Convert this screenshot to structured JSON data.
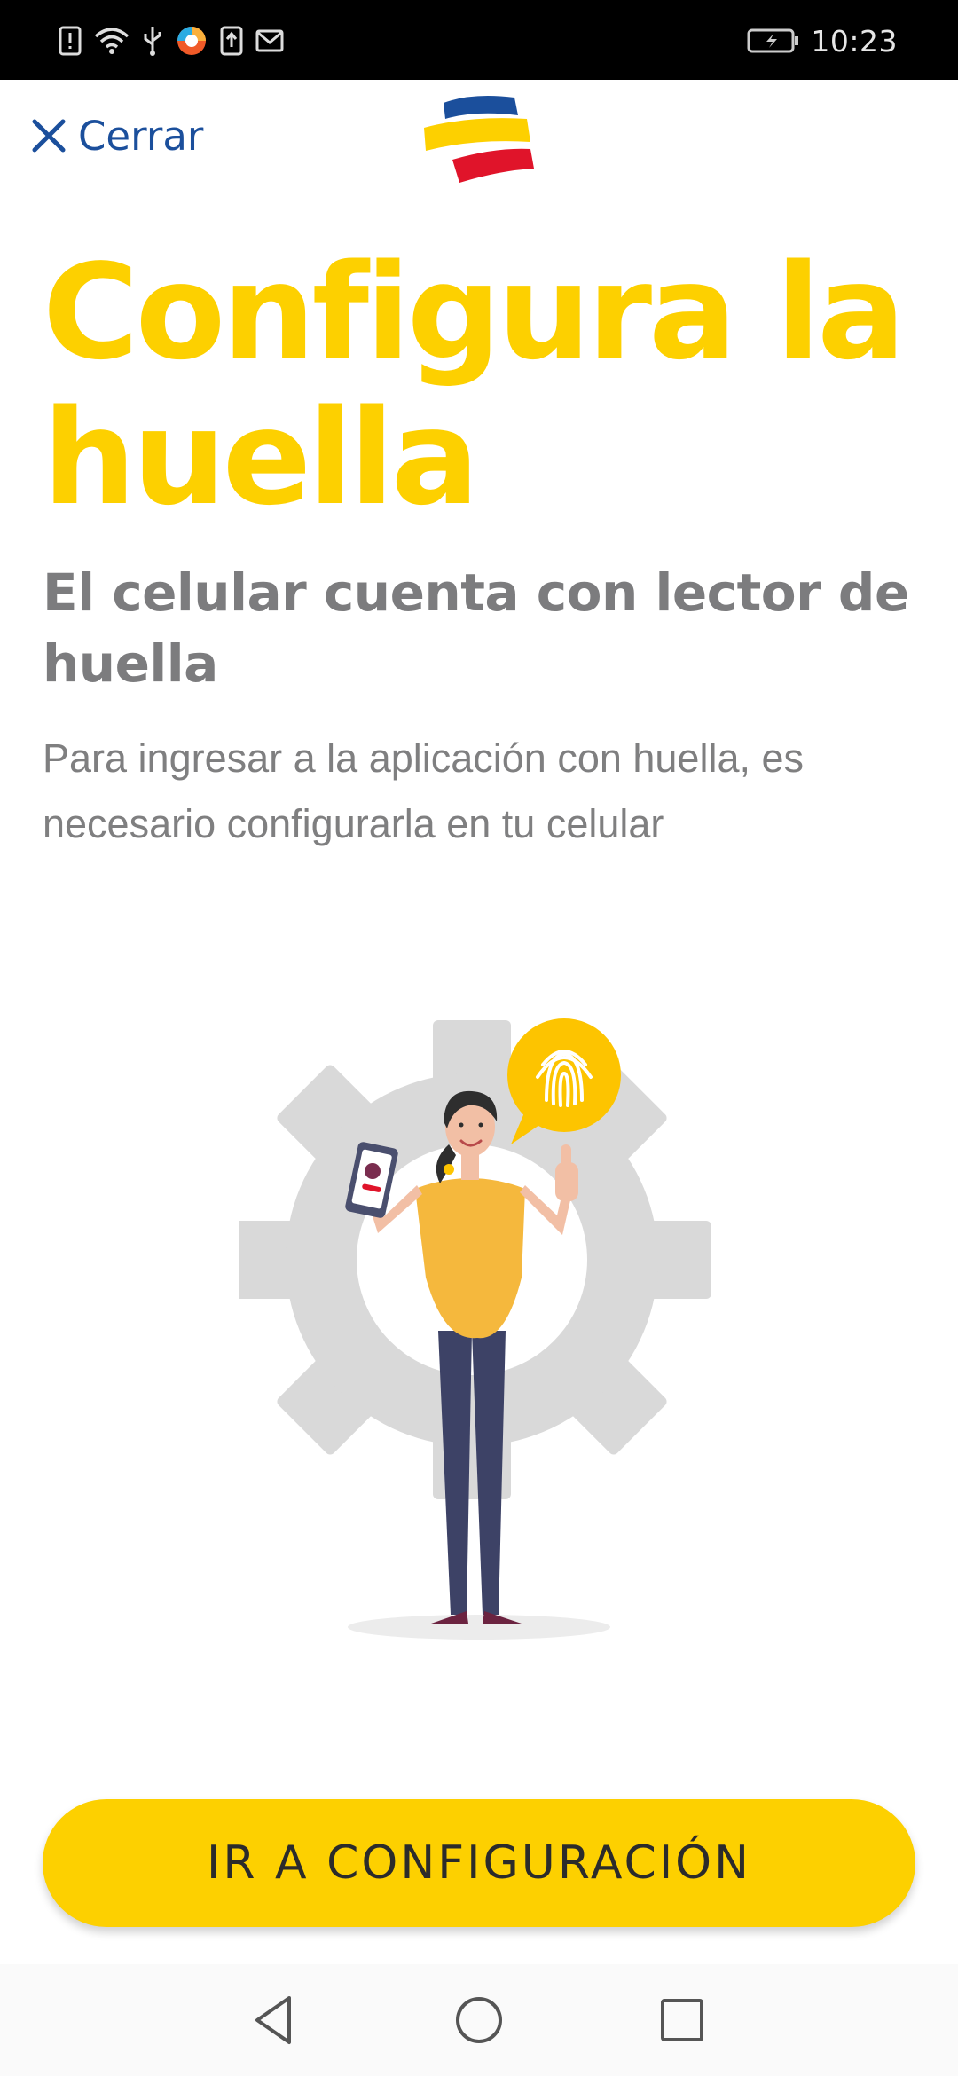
{
  "status_bar": {
    "time": "10:23",
    "icons": [
      "sim-alert-icon",
      "wifi-icon",
      "usb-icon",
      "browser-icon",
      "upload-icon",
      "gmail-icon"
    ],
    "battery_icon": "battery-charging-icon"
  },
  "header": {
    "close_label": "Cerrar",
    "close_icon": "close-icon",
    "logo": "bank-logo"
  },
  "content": {
    "title": "Configura la huella",
    "subtitle": "El celular cuenta con lector de huella",
    "description": "Para ingresar a la aplicación con huella, es necesario configurarla en tu celular"
  },
  "illustration": {
    "name": "woman-with-phone-fingerprint-illustration"
  },
  "cta": {
    "label": "IR A CONFIGURACIÓN"
  },
  "nav": {
    "back_icon": "back-icon",
    "home_icon": "home-icon",
    "recents_icon": "recents-icon"
  },
  "colors": {
    "accent_yellow": "#fdd000",
    "brand_blue": "#1b4f9c",
    "brand_red": "#e0142a",
    "text_gray": "#7c7c7e"
  }
}
